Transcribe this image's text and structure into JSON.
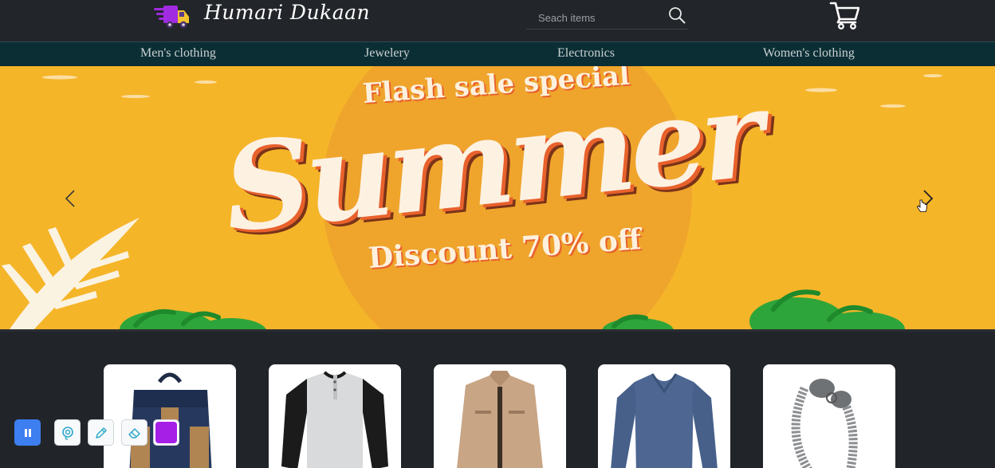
{
  "header": {
    "brand": "Humari Dukaan",
    "search_placeholder": "Seach items",
    "icons": {
      "logo": "delivery-truck-icon",
      "search": "search-icon",
      "cart": "cart-icon"
    }
  },
  "nav": {
    "categories": [
      "Men's clothing",
      "Jewelery",
      "Electronics",
      "Women's clothing"
    ]
  },
  "banner": {
    "kicker": "Flash sale special",
    "headline": "Summer",
    "subline": "Discount 70% off",
    "prev_icon": "chevron-left-icon",
    "next_icon": "chevron-right-icon"
  },
  "products": {
    "items": [
      {
        "image": "backpack-image"
      },
      {
        "image": "raglan-tshirt-image"
      },
      {
        "image": "jacket-image"
      },
      {
        "image": "blue-sweater-image"
      },
      {
        "image": "chain-bracelet-image"
      }
    ]
  },
  "toolbar": {
    "icons": [
      "pause-icon",
      "lasso-icon",
      "pen-icon",
      "eraser-icon"
    ],
    "swatch_color": "#a51fe6"
  },
  "colors": {
    "header_bg": "#222529",
    "nav_bg": "#0b2e34",
    "banner_bg": "#f5b529",
    "accent_orange": "#e8612c",
    "page_bg": "#212529"
  }
}
